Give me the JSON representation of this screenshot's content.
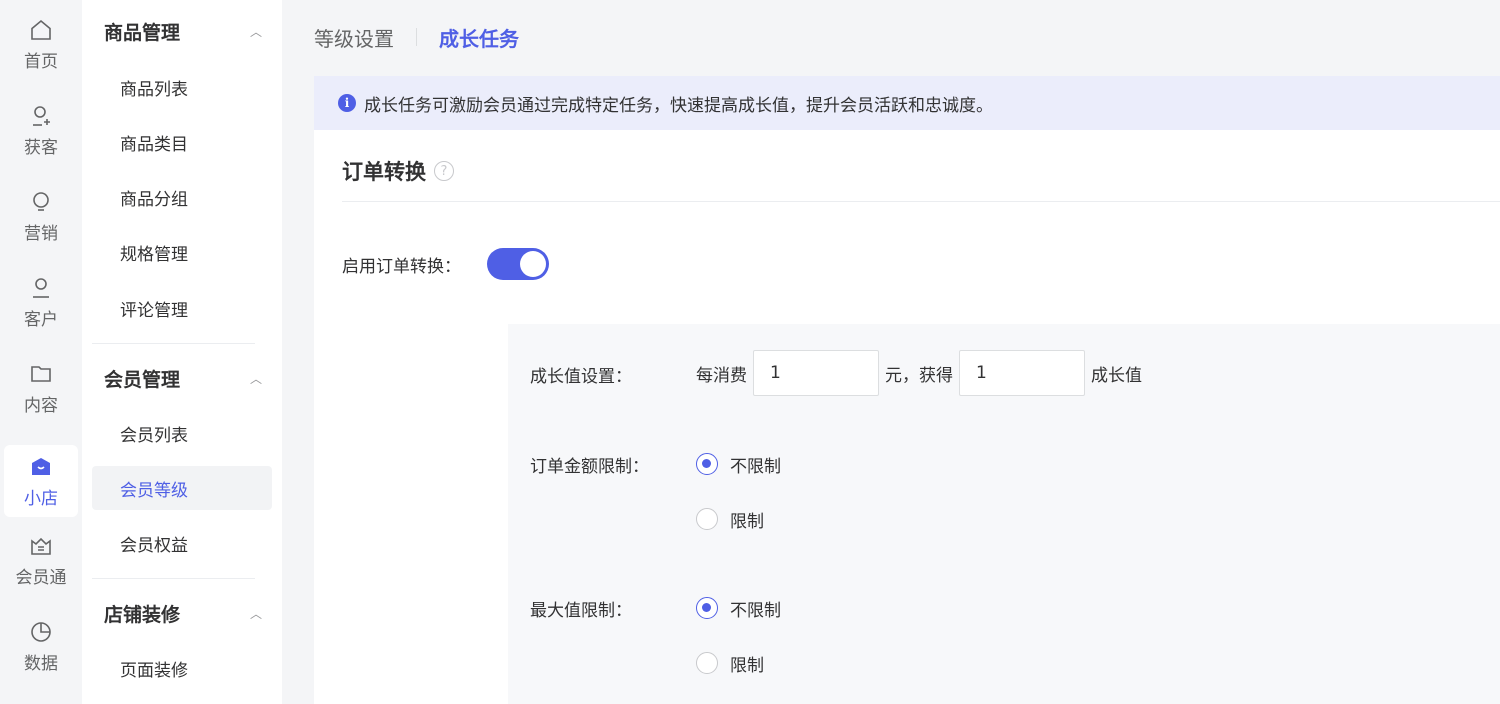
{
  "rail": {
    "items": [
      {
        "label": "首页",
        "icon": "home-icon"
      },
      {
        "label": "获客",
        "icon": "user-add-icon"
      },
      {
        "label": "营销",
        "icon": "bulb-icon"
      },
      {
        "label": "客户",
        "icon": "user-icon"
      },
      {
        "label": "内容",
        "icon": "folder-icon"
      },
      {
        "label": "小店",
        "icon": "shop-icon",
        "active": true
      },
      {
        "label": "会员通",
        "icon": "crown-icon"
      },
      {
        "label": "数据",
        "icon": "pie-chart-icon"
      }
    ]
  },
  "submenu": {
    "groups": [
      {
        "title": "商品管理",
        "items": [
          "商品列表",
          "商品类目",
          "商品分组",
          "规格管理",
          "评论管理"
        ]
      },
      {
        "title": "会员管理",
        "items": [
          "会员列表",
          "会员等级",
          "会员权益"
        ]
      },
      {
        "title": "店铺装修",
        "items": [
          "页面装修"
        ]
      }
    ],
    "active_item": "会员等级"
  },
  "tabs": [
    {
      "label": "等级设置",
      "active": false
    },
    {
      "label": "成长任务",
      "active": true
    }
  ],
  "notice": "成长任务可激励会员通过完成特定任务，快速提高成长值，提升会员活跃和忠诚度。",
  "section": {
    "title": "订单转换",
    "enable_label": "启用订单转换：",
    "enabled": true
  },
  "growth": {
    "label": "成长值设置：",
    "prefix": "每消费",
    "amount": "1",
    "middle": "元，获得",
    "points": "1",
    "suffix": "成长值"
  },
  "order_limit": {
    "label": "订单金额限制：",
    "options": [
      "不限制",
      "限制"
    ],
    "selected": "不限制"
  },
  "max_limit": {
    "label": "最大值限制：",
    "options": [
      "不限制",
      "限制"
    ],
    "selected": "不限制"
  },
  "colors": {
    "accent": "#4f5fe5",
    "notice_bg": "#ebedfb"
  }
}
